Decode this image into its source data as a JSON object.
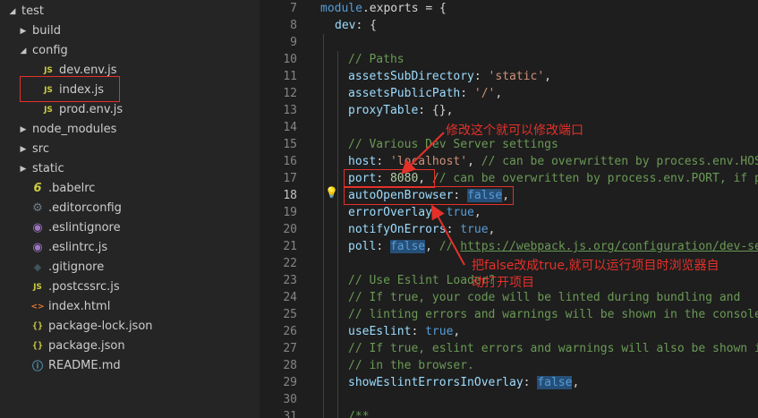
{
  "explorer": {
    "items": [
      {
        "label": "test",
        "icon": "chevron-down-icon",
        "type": "folder"
      },
      {
        "label": "build",
        "icon": "chevron-right-icon",
        "type": "folder"
      },
      {
        "label": "config",
        "icon": "chevron-down-icon",
        "type": "folder"
      },
      {
        "label": "dev.env.js",
        "icon": "js-file-icon",
        "icon_text": "JS",
        "type": "file"
      },
      {
        "label": "index.js",
        "icon": "js-file-icon",
        "icon_text": "JS",
        "type": "file",
        "selected": true
      },
      {
        "label": "prod.env.js",
        "icon": "js-file-icon",
        "icon_text": "JS",
        "type": "file"
      },
      {
        "label": "node_modules",
        "icon": "chevron-right-icon",
        "type": "folder"
      },
      {
        "label": "src",
        "icon": "chevron-right-icon",
        "type": "folder"
      },
      {
        "label": "static",
        "icon": "chevron-right-icon",
        "type": "folder"
      },
      {
        "label": ".babelrc",
        "icon": "babel-icon",
        "icon_text": "6",
        "type": "file"
      },
      {
        "label": ".editorconfig",
        "icon": "gear-icon",
        "icon_text": "⚙",
        "type": "file"
      },
      {
        "label": ".eslintignore",
        "icon": "eslint-icon",
        "icon_text": "◉",
        "type": "file"
      },
      {
        "label": ".eslintrc.js",
        "icon": "eslint-icon",
        "icon_text": "◉",
        "type": "file"
      },
      {
        "label": ".gitignore",
        "icon": "git-icon",
        "icon_text": "◆",
        "type": "file"
      },
      {
        "label": ".postcssrc.js",
        "icon": "js-file-icon",
        "icon_text": "JS",
        "type": "file"
      },
      {
        "label": "index.html",
        "icon": "html-icon",
        "icon_text": "<>",
        "type": "file"
      },
      {
        "label": "package-lock.json",
        "icon": "json-icon",
        "icon_text": "{}",
        "type": "file"
      },
      {
        "label": "package.json",
        "icon": "json-icon",
        "icon_text": "{}",
        "type": "file"
      },
      {
        "label": "README.md",
        "icon": "info-icon",
        "icon_text": "ⓘ",
        "type": "file"
      }
    ]
  },
  "editor": {
    "active_line": 18,
    "line_numbers": [
      "7",
      "8",
      "9",
      "10",
      "11",
      "12",
      "13",
      "14",
      "15",
      "16",
      "17",
      "18",
      "19",
      "20",
      "21",
      "22",
      "23",
      "24",
      "25",
      "26",
      "27",
      "28",
      "29",
      "30",
      "31"
    ],
    "code": {
      "l7_a": "module",
      "l7_b": ".exports = {",
      "l8_a": "dev",
      "l8_b": ": {",
      "l10": "// Paths",
      "l11_a": "assetsSubDirectory",
      "l11_b": ": ",
      "l11_c": "'static'",
      "l11_d": ",",
      "l12_a": "assetsPublicPath",
      "l12_b": ": ",
      "l12_c": "'/'",
      "l12_d": ",",
      "l13_a": "proxyTable",
      "l13_b": ": {},",
      "l16": "// Various Dev Server settings",
      "l17_a": "host",
      "l17_b": ": ",
      "l17_c": "'localhost'",
      "l17_d": ", ",
      "l17_e": "// can be overwritten by process.env.HOST",
      "l18x_a": "port",
      "l18x_b": ": ",
      "l18x_c": "8080",
      "l18x_d": ", ",
      "l18x_e": "// can be overwritten by process.env.PORT, if po",
      "l18_a": "autoOpenBrowser",
      "l18_b": ": ",
      "l18_c": "false",
      "l18_d": ",",
      "l19_a": "errorOverlay",
      "l19_b": ": ",
      "l19_c": "true",
      "l19_d": ",",
      "l20_a": "notifyOnErrors",
      "l20_b": ": ",
      "l20_c": "true",
      "l20_d": ",",
      "l21_a": "poll",
      "l21_b": ": ",
      "l21_c": "false",
      "l21_d": ", ",
      "l21_e": "// ",
      "l21_f": "https://webpack.js.org/configuration/dev-ser",
      "l23": "// Use Eslint Loader?",
      "l24": "// If true, your code will be linted during bundling and",
      "l25": "// linting errors and warnings will be shown in the console.",
      "l26_a": "useEslint",
      "l26_b": ": ",
      "l26_c": "true",
      "l26_d": ",",
      "l27": "// If true, eslint errors and warnings will also be shown in",
      "l28": "// in the browser.",
      "l29_a": "showEslintErrorsInOverlay",
      "l29_b": ": ",
      "l29_c": "false",
      "l29_d": ",",
      "l31": "/**"
    }
  },
  "annotations": {
    "port_note": "修改这个就可以修改端口",
    "browser_note_line1": "把false改成true,就可以运行项目时浏览器自",
    "browser_note_line2": "动打开项目"
  },
  "colors": {
    "annotation_red": "#e5302a",
    "editor_bg": "#1e1e1e",
    "sidebar_bg": "#252526"
  }
}
